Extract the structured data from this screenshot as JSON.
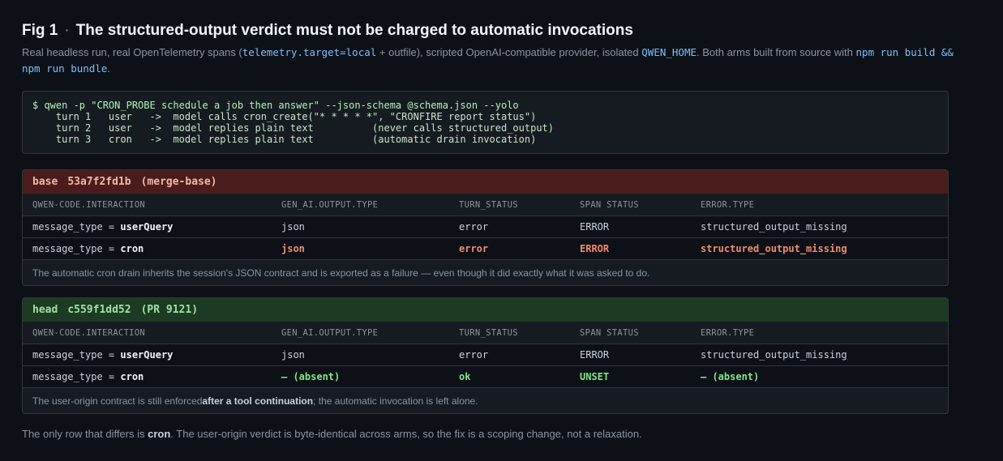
{
  "title": {
    "fig": "Fig 1",
    "sep": "·",
    "text": "The structured-output verdict must not be charged to automatic invocations"
  },
  "caption": {
    "p1": "Real headless run, real OpenTelemetry spans (",
    "c1": "telemetry.target=local",
    "p2": " + outfile), scripted OpenAI-compatible provider, isolated ",
    "c2": "QWEN_HOME",
    "p3": ". Both arms built from source with ",
    "c3": "npm run build && npm run bundle",
    "p4": "."
  },
  "terminal": {
    "command": "$ qwen -p \"CRON_PROBE schedule a job then answer\" --json-schema @schema.json --yolo",
    "lines": [
      "    turn 1   user   ->  model calls cron_create(\"* * * * *\", \"CRONFIRE report status\")",
      "    turn 2   user   ->  model replies plain text          (never calls structured_output)",
      "    turn 3   cron   ->  model replies plain text          (automatic drain invocation)"
    ]
  },
  "columns": [
    "QWEN-CODE.INTERACTION",
    "GEN_AI.OUTPUT.TYPE",
    "TURN_STATUS",
    "SPAN STATUS",
    "ERROR.TYPE"
  ],
  "base": {
    "label": "base",
    "sha": "53a7f2fd1b",
    "ref": "(merge-base)",
    "rows": [
      {
        "prefix": "message_type = ",
        "kind": "userQuery",
        "output": "json",
        "turn": "error",
        "span": "ERROR",
        "error": "structured_output_missing"
      },
      {
        "prefix": "message_type = ",
        "kind": "cron",
        "output": "json",
        "turn": "error",
        "span": "ERROR",
        "error": "structured_output_missing"
      }
    ],
    "note": "The automatic cron drain inherits the session's JSON contract and is exported as a failure — even though it did exactly what it was asked to do."
  },
  "head": {
    "label": "head",
    "sha": "c559f1dd52",
    "ref": "(PR 9121)",
    "rows": [
      {
        "prefix": "message_type = ",
        "kind": "userQuery",
        "output": "json",
        "turn": "error",
        "span": "ERROR",
        "error": "structured_output_missing"
      },
      {
        "prefix": "message_type = ",
        "kind": "cron",
        "output": "— (absent)",
        "turn": "ok",
        "span": "UNSET",
        "error": "— (absent)"
      }
    ],
    "note_a": "The user-origin contract is still enforced ",
    "note_b": "after a tool continuation",
    "note_c": "; the automatic invocation is left alone."
  },
  "footer": {
    "a": "The only row that differs is ",
    "b": "cron",
    "c": ". The user-origin verdict is byte-identical across arms, so the fix is a scoping change, not a relaxation."
  }
}
